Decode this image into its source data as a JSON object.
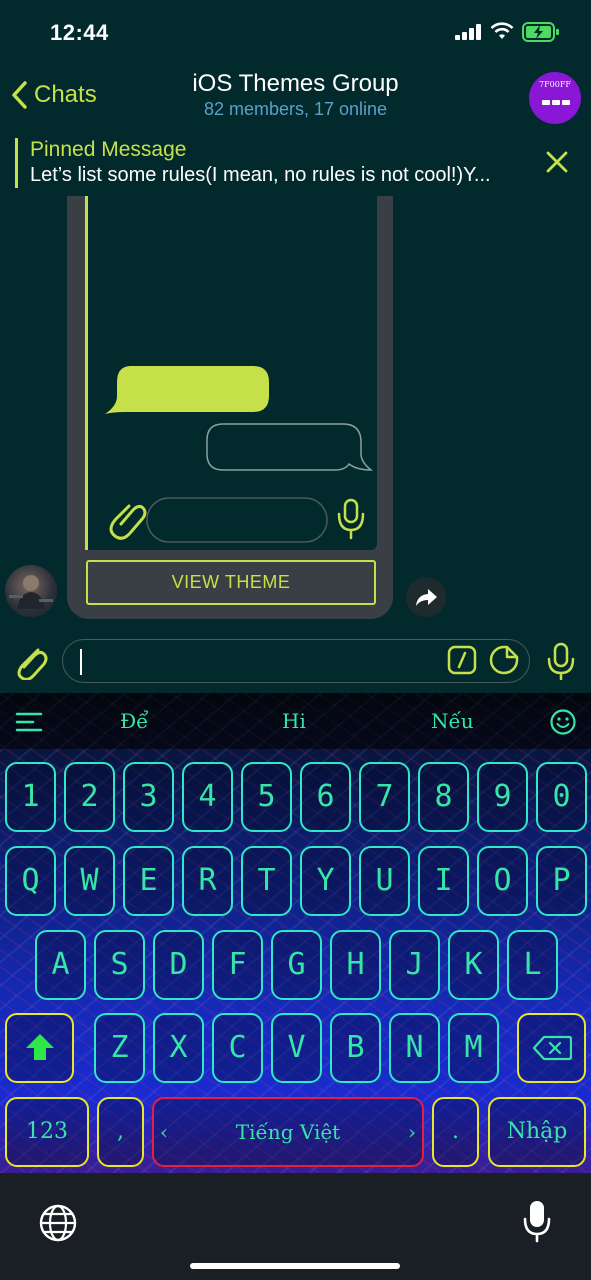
{
  "status": {
    "time": "12:44"
  },
  "header": {
    "back_label": "Chats",
    "title": "iOS Themes Group",
    "subtitle": "82 members, 17 online",
    "avatar_text": "7F00FF"
  },
  "pinned": {
    "title": "Pinned Message",
    "text": "Let’s list some rules(I mean, no rules is not cool!)Y..."
  },
  "message": {
    "button_label": "VIEW THEME"
  },
  "input": {
    "value": ""
  },
  "keyboard": {
    "suggestions": [
      "Để",
      "Hi",
      "Nếu"
    ],
    "row_numbers": [
      "1",
      "2",
      "3",
      "4",
      "5",
      "6",
      "7",
      "8",
      "9",
      "0"
    ],
    "row_top": [
      "Q",
      "W",
      "E",
      "R",
      "T",
      "Y",
      "U",
      "I",
      "O",
      "P"
    ],
    "row_mid": [
      "A",
      "S",
      "D",
      "F",
      "G",
      "H",
      "J",
      "K",
      "L"
    ],
    "row_bot": [
      "Z",
      "X",
      "C",
      "V",
      "B",
      "N",
      "M"
    ],
    "num_label": "123",
    "comma": ",",
    "space_label": "Tiếng Việt",
    "period": ".",
    "return_label": "Nhập"
  },
  "colors": {
    "accent": "#c6e04a",
    "key_border": "#2ee8c8",
    "key_text": "#36e6a6",
    "special_key_border": "#e8e62a",
    "space_key_border": "#e61f3c",
    "group_avatar": "#8a17d6"
  }
}
